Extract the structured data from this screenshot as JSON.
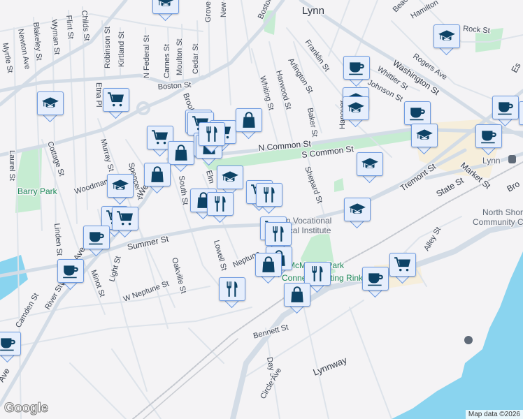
{
  "map": {
    "city_label": "Lynn",
    "streets": [
      "Myrtle St",
      "Blakeley St",
      "Newton Ave",
      "Wyman St",
      "Flint St",
      "Childs St",
      "Robinson St",
      "Kirtland St",
      "N Federal St",
      "Carnes St",
      "Moulton St",
      "Cedar St",
      "Boston St",
      "Boston St",
      "Etna Pl",
      "Brook",
      "Cottage St",
      "Murray St",
      "Spencer St",
      "Woodman",
      "South St",
      "Elm",
      "Laurel St",
      "N Common St",
      "S Common St",
      "Whiting St",
      "Harwood St",
      "Baker St",
      "Arlington St",
      "Franklin St",
      "Hanover",
      "Washington St",
      "Whittier St",
      "Johnson St",
      "Rogers Ave",
      "Rock St",
      "Hamilton",
      "Beaco",
      "Shepard St",
      "Tremont St",
      "Market St",
      "State St",
      "Summer St",
      "Western",
      "Western Ave",
      "Linden St",
      "Oakville St",
      "Lowell St",
      "Neptune",
      "Light St",
      "W Neptune St",
      "Minot St",
      "River St",
      "Camden St",
      "Bennett St",
      "Alley St",
      "Lynnway",
      "Day St",
      "Circle Ave",
      "Ave",
      "Bro",
      "Es",
      "Grove",
      "New"
    ],
    "parks": [
      "Barry Park",
      "McManus Park",
      "Connery Skating Rink"
    ],
    "poi": [
      "Lynn Vocational",
      "Technical Institute",
      "North Shore",
      "Community College",
      "Lynn"
    ],
    "markers": [
      "school",
      "cart",
      "school",
      "school",
      "coffee",
      "school",
      "school",
      "coffee",
      "school",
      "coffee",
      "coffee",
      "coffee",
      "school",
      "school",
      "cart",
      "cart",
      "cart",
      "cart",
      "bag",
      "bag",
      "bag",
      "bag",
      "restaurant",
      "bag",
      "school",
      "school",
      "bag",
      "restaurant",
      "cart",
      "restaurant",
      "cart",
      "cart",
      "coffee",
      "cart",
      "restaurant",
      "bag",
      "bag",
      "restaurant",
      "coffee",
      "cart",
      "coffee",
      "restaurant",
      "bag",
      "coffee"
    ],
    "colors": {
      "background": "#f4f3f5",
      "road": "#d3dce6",
      "water": "#8ad4ef",
      "park": "#c6ecd2",
      "downtown": "#f6eedb",
      "marker_fill": "#e6eefc",
      "marker_icon": "#0d4366"
    }
  },
  "attribution": "Map data ©2026",
  "logo": "Google"
}
